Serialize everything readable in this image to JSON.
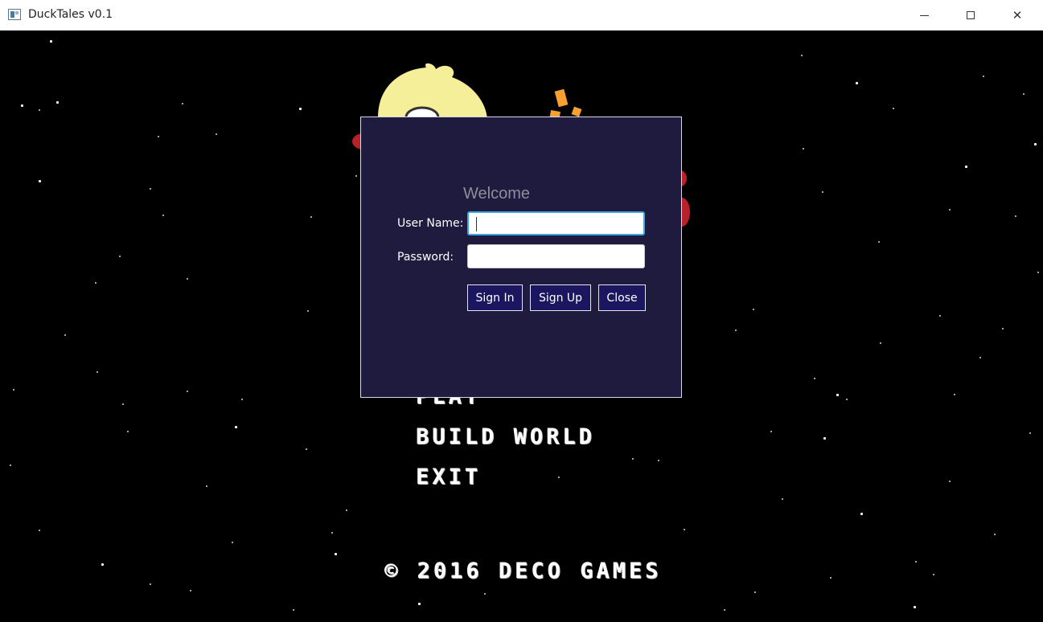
{
  "window": {
    "title": "DuckTales v0.1",
    "controls": {
      "minimize": "minimize-icon",
      "maximize": "maximize-icon",
      "close": "✕"
    }
  },
  "menu": {
    "items": [
      {
        "label": "PLAY"
      },
      {
        "label": "BUILD WORLD"
      },
      {
        "label": "EXIT"
      }
    ],
    "copyright": "© 2016 DECO GAMES"
  },
  "login": {
    "title": "Welcome",
    "username_label": "User Name:",
    "password_label": "Password:",
    "username_value": "",
    "password_value": "",
    "buttons": {
      "sign_in": "Sign In",
      "sign_up": "Sign Up",
      "close": "Close"
    }
  },
  "colors": {
    "background": "#000000",
    "dialog_bg": "#1e1b3f",
    "button_bg": "#1a1660",
    "focus_ring": "#3fa7e0",
    "duck_yellow": "#f5ef9a",
    "accent_red": "#b8202a",
    "accent_orange": "#f5a030"
  }
}
